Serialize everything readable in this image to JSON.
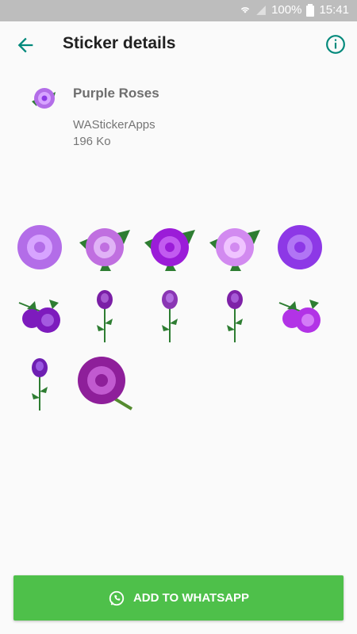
{
  "status_bar": {
    "battery_percent": "100%",
    "time": "15:41"
  },
  "header": {
    "title": "Sticker details"
  },
  "pack": {
    "name": "Purple Roses",
    "publisher": "WAStickerApps",
    "size": "196 Ko"
  },
  "stickers": [
    {
      "kind": "rose-head",
      "color": "#b36de8",
      "accent": "#d7a4ff"
    },
    {
      "kind": "rose-leaves",
      "color": "#c06fe0",
      "accent": "#e0b2f6"
    },
    {
      "kind": "rose-leaves",
      "color": "#9b1cd8",
      "accent": "#c25bf0"
    },
    {
      "kind": "rose-leaves",
      "color": "#d28af0",
      "accent": "#efc3ff"
    },
    {
      "kind": "rose-head",
      "color": "#8d38e6",
      "accent": "#b175f5"
    },
    {
      "kind": "rose-branch",
      "color": "#7d1bbd",
      "accent": "#a45ae0"
    },
    {
      "kind": "rose-stem",
      "color": "#7a1ea6",
      "accent": "#a65ad0"
    },
    {
      "kind": "rose-stem",
      "color": "#8a36b4",
      "accent": "#b26ee0"
    },
    {
      "kind": "rose-stem",
      "color": "#7e21a8",
      "accent": "#a65ad6"
    },
    {
      "kind": "rose-branch",
      "color": "#b233e6",
      "accent": "#d37cf7"
    },
    {
      "kind": "rose-stem",
      "color": "#6e1fb2",
      "accent": "#9a59e2"
    },
    {
      "kind": "rose-big",
      "color": "#8e1f9a",
      "accent": "#c15ad0"
    }
  ],
  "cta": {
    "label": "ADD TO WHATSAPP"
  },
  "colors": {
    "accent": "#00897b",
    "button": "#4ec04a"
  }
}
